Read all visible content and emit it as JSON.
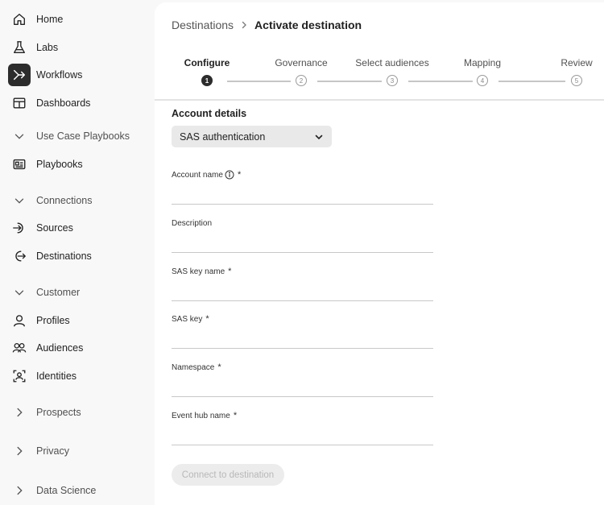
{
  "sidebar": {
    "items": [
      {
        "label": "Home",
        "icon": "home-icon"
      },
      {
        "label": "Labs",
        "icon": "flask-icon"
      },
      {
        "label": "Workflows",
        "icon": "workflow-icon"
      },
      {
        "label": "Dashboards",
        "icon": "dashboard-icon"
      },
      {
        "label": "Use Case Playbooks",
        "icon": "chevron-down-icon"
      },
      {
        "label": "Playbooks",
        "icon": "playbook-icon"
      },
      {
        "label": "Connections",
        "icon": "chevron-down-icon"
      },
      {
        "label": "Sources",
        "icon": "source-icon"
      },
      {
        "label": "Destinations",
        "icon": "destination-icon"
      },
      {
        "label": "Customer",
        "icon": "chevron-down-icon"
      },
      {
        "label": "Profiles",
        "icon": "user-icon"
      },
      {
        "label": "Audiences",
        "icon": "users-icon"
      },
      {
        "label": "Identities",
        "icon": "identity-icon"
      },
      {
        "label": "Prospects",
        "icon": "chevron-right-icon"
      },
      {
        "label": "Privacy",
        "icon": "chevron-right-icon"
      },
      {
        "label": "Data Science",
        "icon": "chevron-right-icon"
      }
    ]
  },
  "breadcrumb": {
    "parent": "Destinations",
    "current": "Activate destination"
  },
  "steps": [
    {
      "label": "Configure",
      "number": "1"
    },
    {
      "label": "Governance",
      "number": "2"
    },
    {
      "label": "Select audiences",
      "number": "3"
    },
    {
      "label": "Mapping",
      "number": "4"
    },
    {
      "label": "Review",
      "number": "5"
    }
  ],
  "form": {
    "section_title": "Account details",
    "auth_select": "SAS authentication",
    "fields": [
      {
        "label": "Account name",
        "required": "*",
        "value": ""
      },
      {
        "label": "Description",
        "required": "",
        "value": ""
      },
      {
        "label": "SAS key name",
        "required": "*",
        "value": ""
      },
      {
        "label": "SAS key",
        "required": "*",
        "value": ""
      },
      {
        "label": "Namespace",
        "required": "*",
        "value": ""
      },
      {
        "label": "Event hub name",
        "required": "*",
        "value": ""
      }
    ],
    "connect_button": "Connect to destination"
  },
  "colors": {
    "active_nav_bg": "#2c2c2c",
    "panel_bg": "#ffffff",
    "sidebar_bg": "#f8f8f8"
  }
}
